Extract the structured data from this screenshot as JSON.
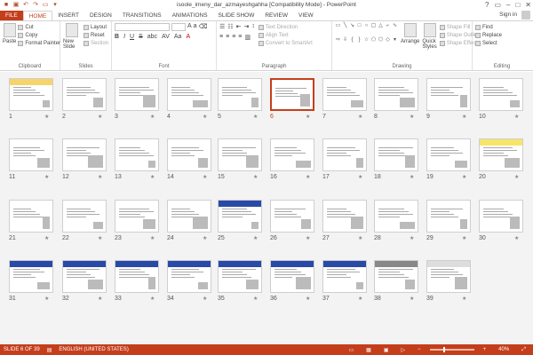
{
  "window": {
    "title": "isoole_imeny_dar_azmayeshgahha [Compatibility Mode] - PowerPoint"
  },
  "tabs": [
    "FILE",
    "HOME",
    "INSERT",
    "DESIGN",
    "TRANSITIONS",
    "ANIMATIONS",
    "SLIDE SHOW",
    "REVIEW",
    "VIEW"
  ],
  "active_tab": "HOME",
  "signin": "Sign in",
  "ribbon": {
    "clipboard": {
      "paste": "Paste",
      "cut": "Cut",
      "copy": "Copy",
      "format_painter": "Format Painter",
      "label": "Clipboard"
    },
    "slides": {
      "new_slide": "New Slide",
      "layout": "Layout",
      "reset": "Reset",
      "section": "Section",
      "label": "Slides"
    },
    "font": {
      "label": "Font",
      "bold": "B",
      "italic": "I",
      "underline": "U",
      "strike": "S",
      "shadow": "abc",
      "spacing": "AV",
      "case": "Aa",
      "color": "A"
    },
    "paragraph": {
      "text_direction": "Text Direction",
      "align_text": "Align Text",
      "smartart": "Convert to SmartArt",
      "label": "Paragraph"
    },
    "drawing": {
      "arrange": "Arrange",
      "quick_styles": "Quick Styles",
      "shape_fill": "Shape Fill",
      "shape_outline": "Shape Outline",
      "shape_effects": "Shape Effects",
      "label": "Drawing"
    },
    "editing": {
      "find": "Find",
      "replace": "Replace",
      "select": "Select",
      "label": "Editing"
    }
  },
  "slides_selected": 6,
  "slide_numbers": [
    "1",
    "2",
    "3",
    "4",
    "5",
    "6",
    "7",
    "8",
    "9",
    "10",
    "11",
    "12",
    "13",
    "14",
    "15",
    "16",
    "17",
    "18",
    "19",
    "20",
    "21",
    "22",
    "23",
    "24",
    "25",
    "26",
    "27",
    "28",
    "29",
    "30",
    "31",
    "32",
    "33",
    "34",
    "35",
    "36",
    "37",
    "38",
    "39"
  ],
  "status": {
    "slide_info": "SLIDE 6 OF 39",
    "language": "ENGLISH (UNITED STATES)",
    "zoom": "40%",
    "minus": "−",
    "plus": "+"
  }
}
